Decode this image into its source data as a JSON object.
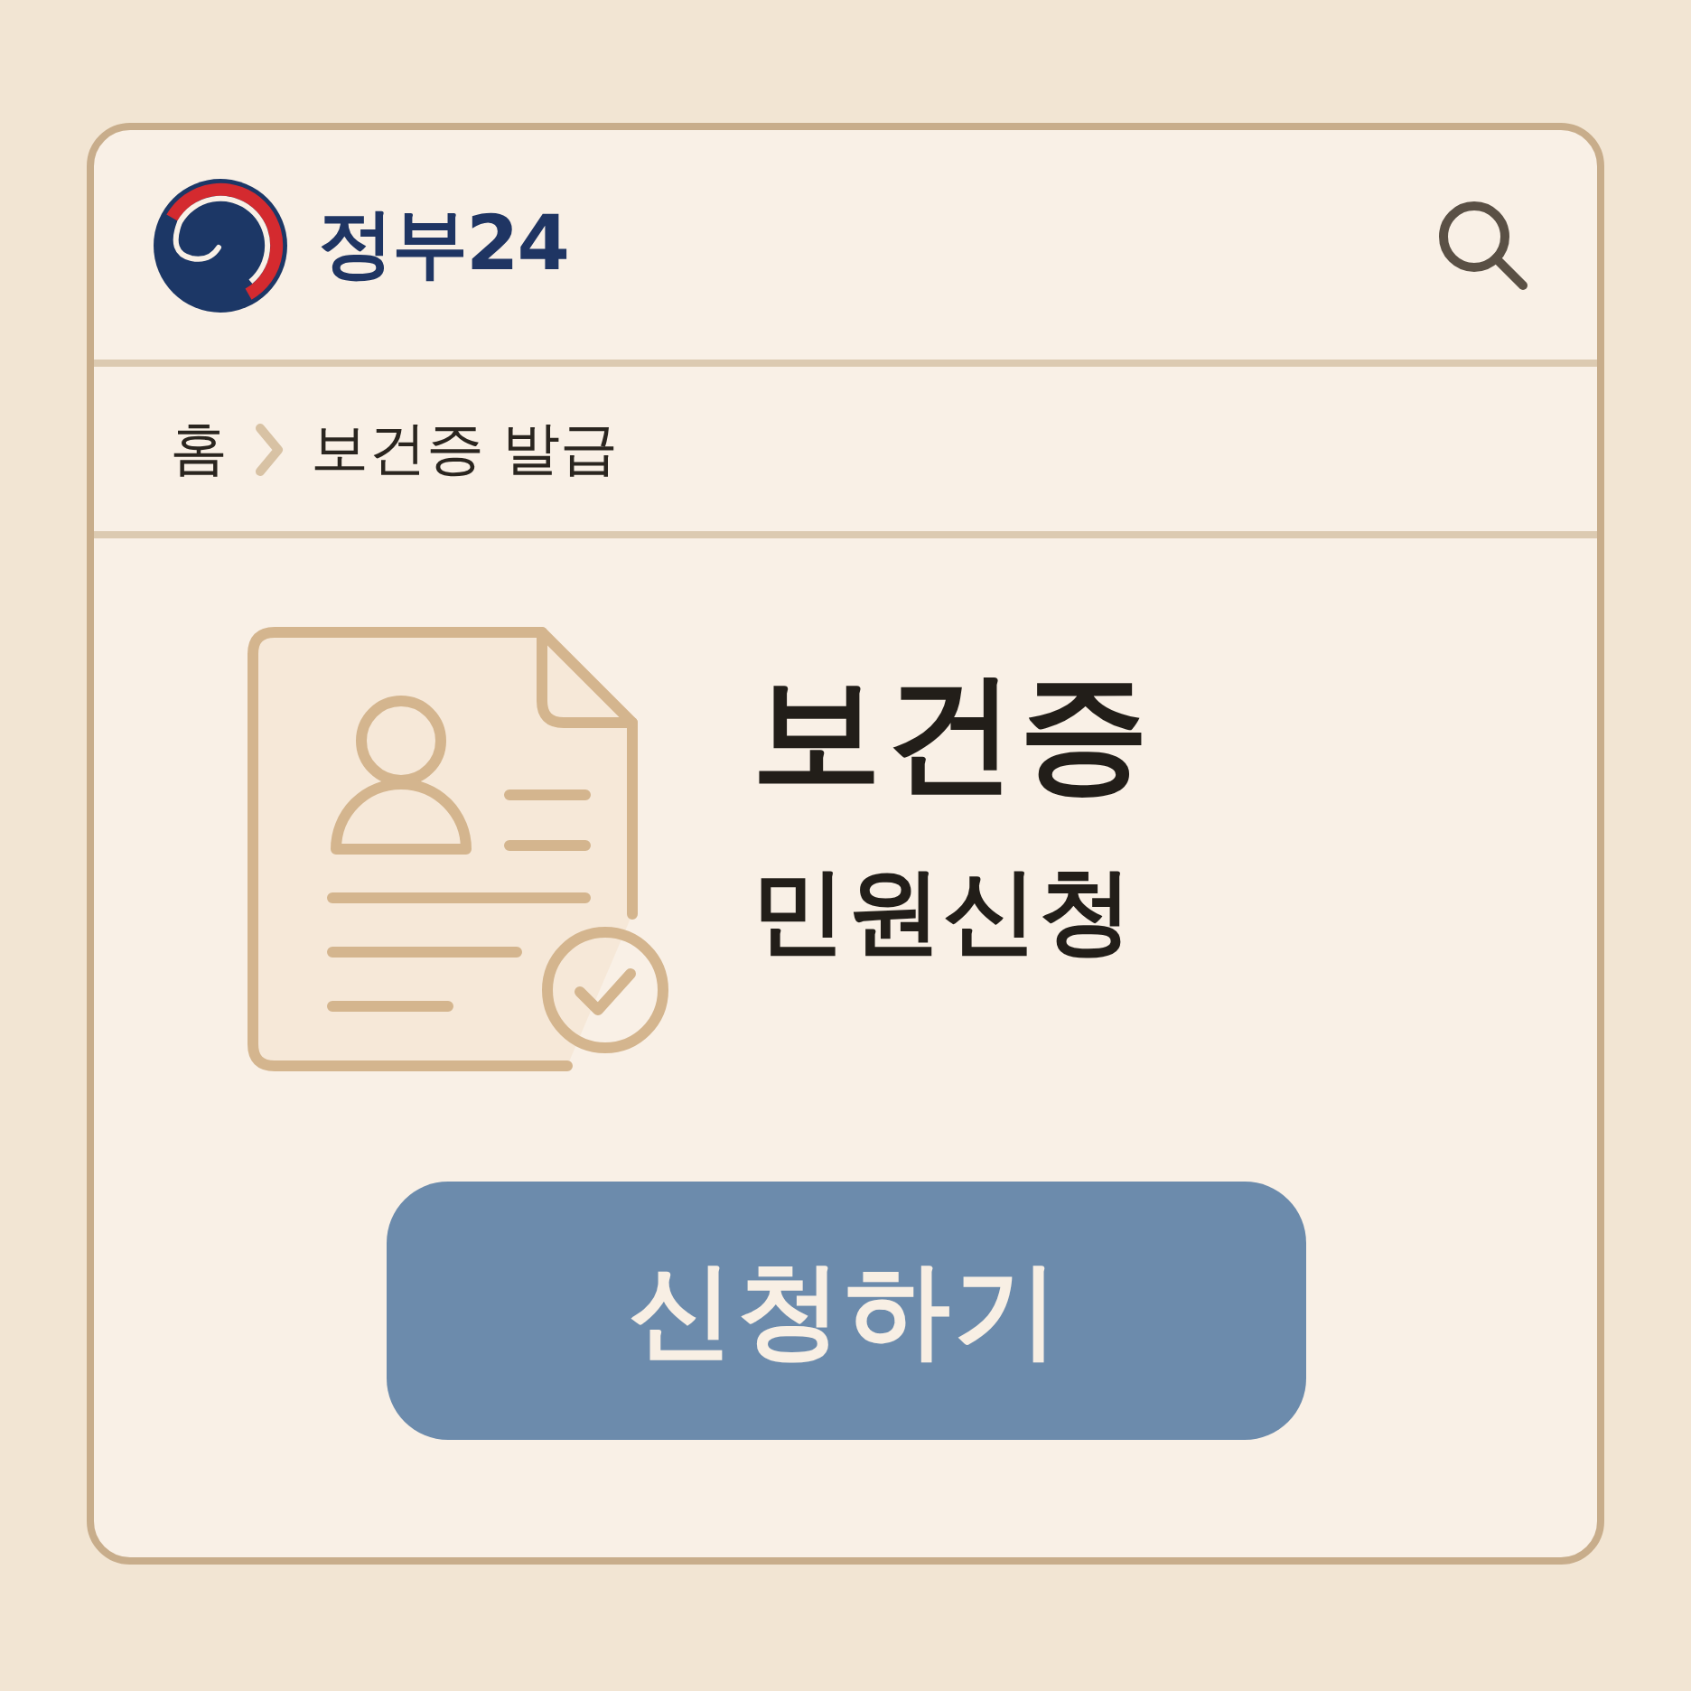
{
  "header": {
    "logo_text": "정부24"
  },
  "breadcrumb": [
    {
      "label": "홈"
    },
    {
      "label": "보건증 발급"
    }
  ],
  "service": {
    "title": "보건증",
    "subtitle": "민원신청"
  },
  "primary_button": {
    "label": "신청하기"
  }
}
